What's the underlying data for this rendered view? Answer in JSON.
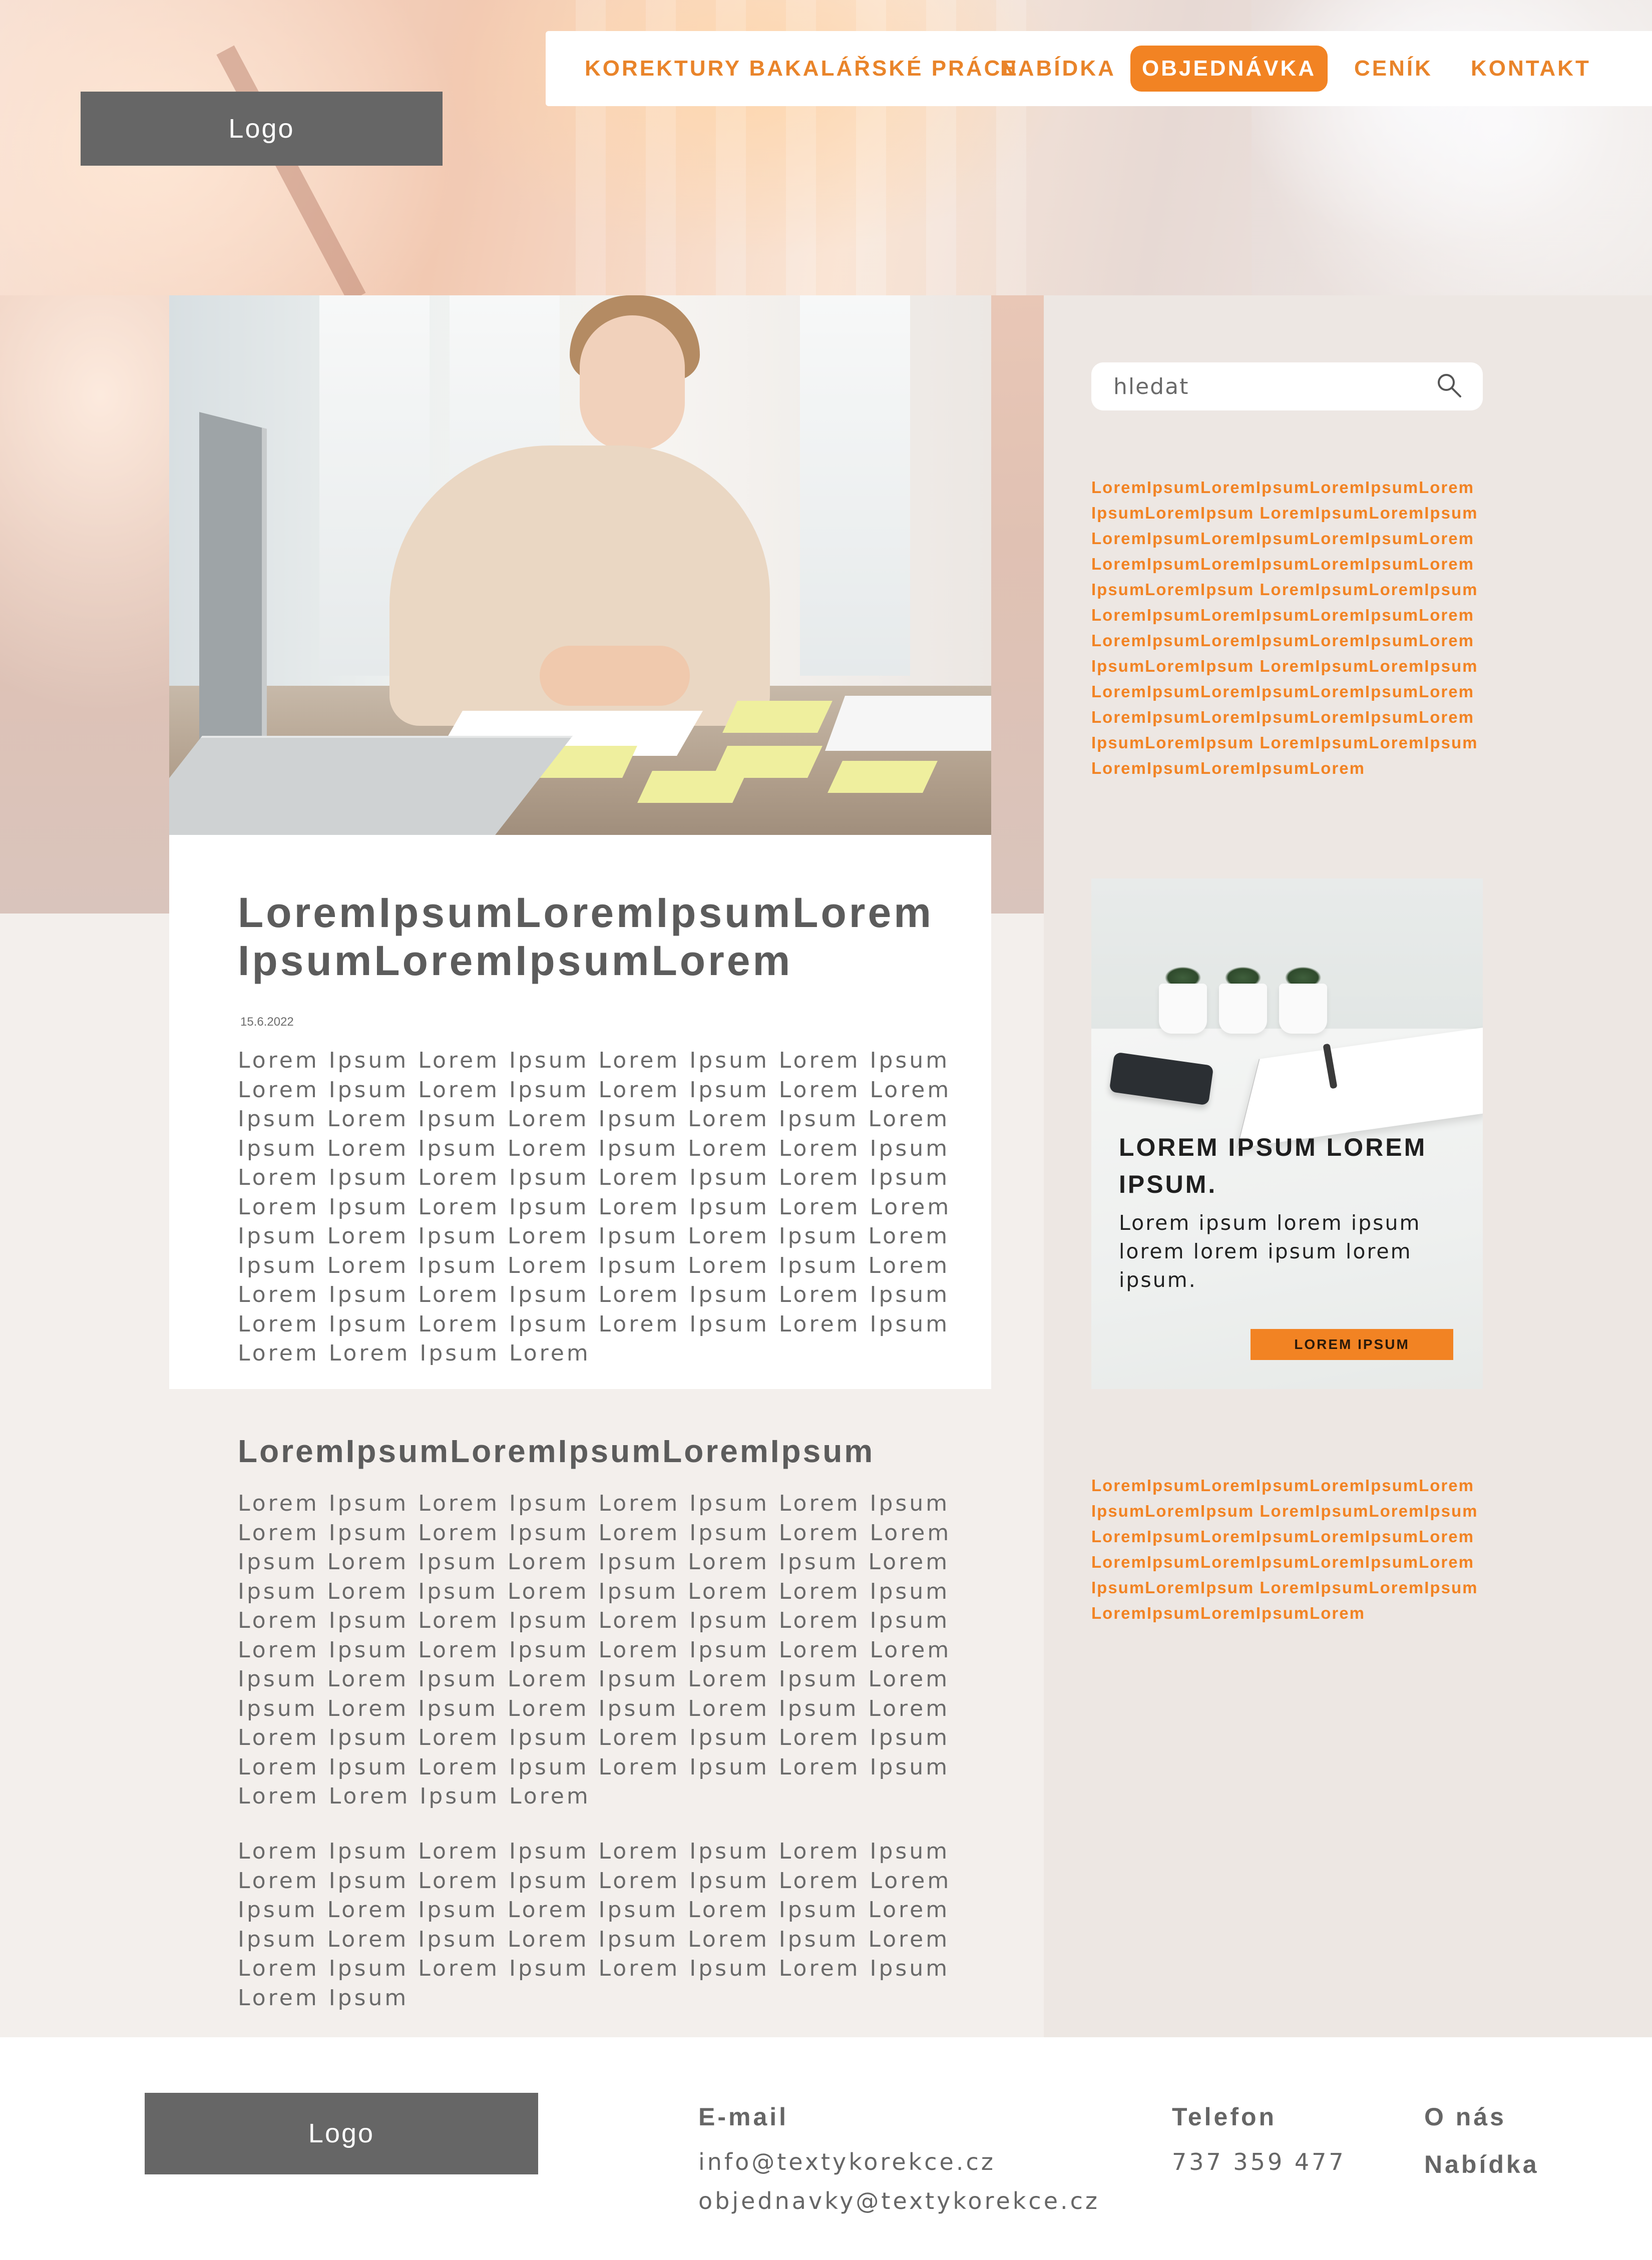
{
  "nav": {
    "items": [
      {
        "label": "KOREKTURY BAKALÁŘSKÉ PRÁCE"
      },
      {
        "label": "NABÍDKA"
      },
      {
        "label": "OBJEDNÁVKA",
        "active": true
      },
      {
        "label": "CENÍK"
      },
      {
        "label": "KONTAKT"
      }
    ]
  },
  "header": {
    "logo_label": "Logo"
  },
  "article": {
    "title": "LoremIpsumLoremIpsumLorem IpsumLoremIpsumLorem",
    "date": "15.6.2022",
    "body": "Lorem Ipsum Lorem Ipsum Lorem Ipsum Lorem Ipsum Lorem Ipsum Lorem Ipsum Lorem Ipsum Lorem Lorem Ipsum Lorem Ipsum Lorem Ipsum Lorem Ipsum Lorem Ipsum Lorem Ipsum Lorem Ipsum Lorem Lorem Ipsum Lorem Ipsum Lorem Ipsum Lorem Ipsum Lorem Ipsum Lorem Ipsum Lorem Ipsum Lorem Ipsum Lorem Lorem Ipsum Lorem Ipsum Lorem Ipsum Lorem Ipsum Lorem Ipsum Lorem Ipsum Lorem Ipsum Lorem Ipsum Lorem Lorem Ipsum Lorem Ipsum Lorem Ipsum Lorem Ipsum Lorem Ipsum Lorem Ipsum Lorem Ipsum Lorem Ipsum Lorem Lorem Ipsum Lorem"
  },
  "section2": {
    "title": "LoremIpsumLoremIpsumLoremIpsum",
    "body": "Lorem Ipsum Lorem Ipsum Lorem Ipsum Lorem Ipsum Lorem Ipsum Lorem Ipsum Lorem Ipsum Lorem Lorem Ipsum Lorem Ipsum Lorem Ipsum Lorem Ipsum Lorem Ipsum Lorem Ipsum Lorem Ipsum Lorem Lorem Ipsum Lorem Ipsum Lorem Ipsum Lorem Ipsum Lorem Ipsum Lorem Ipsum Lorem Ipsum Lorem Ipsum Lorem Lorem Ipsum Lorem Ipsum Lorem Ipsum Lorem Ipsum Lorem Ipsum Lorem Ipsum Lorem Ipsum Lorem Ipsum Lorem Lorem Ipsum Lorem Ipsum Lorem Ipsum Lorem Ipsum Lorem Ipsum Lorem Ipsum Lorem Ipsum Lorem Ipsum Lorem Lorem Ipsum Lorem"
  },
  "section3": {
    "body": "Lorem Ipsum Lorem Ipsum Lorem Ipsum Lorem Ipsum Lorem Ipsum Lorem Ipsum Lorem Ipsum Lorem Lorem Ipsum Lorem Ipsum Lorem Ipsum Lorem Ipsum Lorem Ipsum Lorem Ipsum Lorem Ipsum Lorem Ipsum Lorem Lorem Ipsum Lorem Ipsum Lorem Ipsum Lorem Ipsum Lorem Ipsum"
  },
  "sidebar": {
    "search_placeholder": "hledat",
    "text_1": "LoremIpsumLoremIpsumLoremIpsumLorem IpsumLoremIpsum LoremIpsumLoremIpsum LoremIpsumLoremIpsumLoremIpsumLorem LoremIpsumLoremIpsumLoremIpsumLorem IpsumLoremIpsum LoremIpsumLoremIpsum LoremIpsumLoremIpsumLoremIpsumLorem LoremIpsumLoremIpsumLoremIpsumLorem IpsumLoremIpsum LoremIpsumLoremIpsum LoremIpsumLoremIpsumLoremIpsumLorem LoremIpsumLoremIpsumLoremIpsumLorem IpsumLoremIpsum LoremIpsumLoremIpsum LoremIpsumLoremIpsumLorem",
    "text_2": "LoremIpsumLoremIpsumLoremIpsumLorem IpsumLoremIpsum LoremIpsumLoremIpsum LoremIpsumLoremIpsumLoremIpsumLorem LoremIpsumLoremIpsumLoremIpsumLorem IpsumLoremIpsum LoremIpsumLoremIpsum LoremIpsumLoremIpsumLorem",
    "ad": {
      "heading": "LOREM IPSUM LOREM IPSUM.",
      "body": "Lorem ipsum lorem ipsum lorem lorem ipsum lorem ipsum.",
      "button_label": "LOREM IPSUM"
    }
  },
  "footer": {
    "logo_label": "Logo",
    "email_heading": "E-mail",
    "email_1": "info@textykorekce.cz",
    "email_2": "objednavky@textykorekce.cz",
    "phone_heading": "Telefon",
    "phone": "737 359 477",
    "about_label": "O nás",
    "offer_label": "Nabídka"
  },
  "colors": {
    "accent": "#f28323",
    "logo_bg": "#666666",
    "page_bg": "#f3efec",
    "sidebar_bg": "#ede7e3",
    "text": "#5d5d5d"
  },
  "icons": [
    "search-icon"
  ]
}
